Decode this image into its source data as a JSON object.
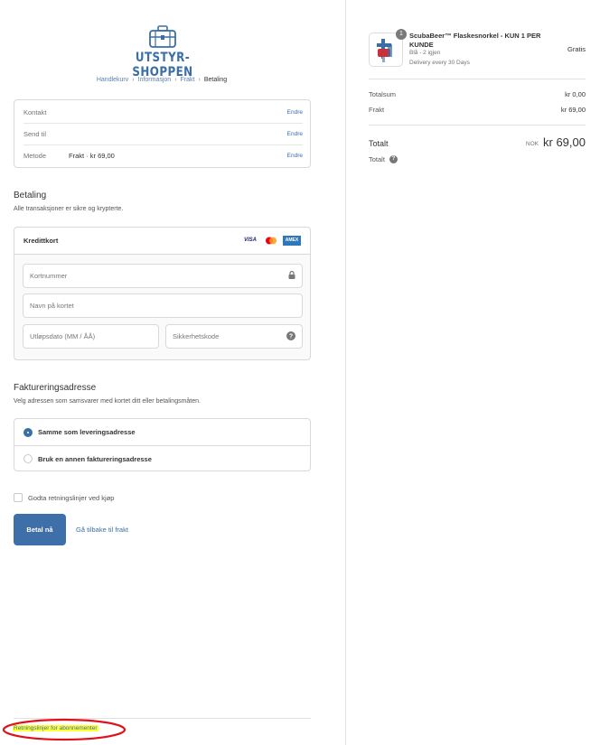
{
  "shop": {
    "name": "UTSTYR-SHOPPEN",
    "logo_icon": "luggage-bag-icon"
  },
  "breadcrumb": {
    "items": [
      "Handlekurv",
      "Informasjon",
      "Frakt"
    ],
    "current": "Betaling"
  },
  "review": {
    "contact_label": "Kontakt",
    "contact_change": "Endre",
    "ship_to_label": "Send til",
    "ship_to_change": "Endre",
    "method_label": "Metode",
    "method_value_prefix": "Frakt · ",
    "method_value_price": "kr 69,00",
    "method_change": "Endre"
  },
  "payment": {
    "title": "Betaling",
    "subtitle": "Alle transaksjoner er sikre og krypterte.",
    "card_title": "Kredittkort",
    "brands": {
      "visa": "VISA",
      "amex": "AMEX"
    },
    "card_number_placeholder": "Kortnummer",
    "card_name_placeholder": "Navn på kortet",
    "expiry_placeholder": "Utløpsdato (MM / ÅÅ)",
    "cvv_placeholder": "Sikkerhetskode"
  },
  "billing": {
    "title": "Faktureringsadresse",
    "subtitle": "Velg adressen som samsvarer med kortet ditt eller betalingsmåten.",
    "option_same": "Samme som leveringsadresse",
    "option_other": "Bruk en annen faktureringsadresse",
    "selected": "same"
  },
  "terms_label": "Godta retningslinjer ved kjøp",
  "pay_button": "Betal nå",
  "back_link": "Gå tilbake til frakt",
  "footer_link": "Retningslinjer for abonnementer",
  "annotation_color": "#e0101a",
  "highlight_color": "#ffff3a",
  "accent_color": "#3e6fa9",
  "order": {
    "product": {
      "quantity": "1",
      "name": "ScubaBeer™ Flaskesnorkel - KUN 1 PER KUNDE",
      "variant": "Blå - 2 igjen",
      "delivery": "Delivery every 30 Days",
      "price": "Gratis"
    },
    "subtotal_label": "Totalsum",
    "subtotal_value": "kr 0,00",
    "shipping_label": "Frakt",
    "shipping_value": "kr 69,00",
    "total_label": "Totalt",
    "total_currency": "NOK",
    "total_value": "kr 69,00",
    "total2_label": "Totalt"
  }
}
